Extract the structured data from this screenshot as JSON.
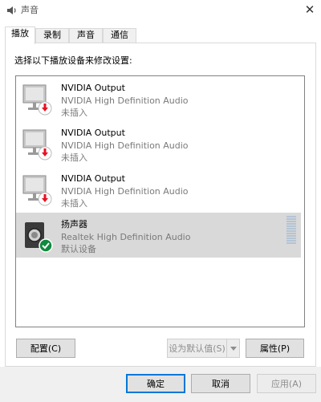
{
  "window": {
    "title": "声音",
    "icon": "speaker-icon",
    "close_glyph": "✕"
  },
  "tabs": [
    {
      "label": "播放",
      "active": true
    },
    {
      "label": "录制",
      "active": false
    },
    {
      "label": "声音",
      "active": false
    },
    {
      "label": "通信",
      "active": false
    }
  ],
  "instruction": "选择以下播放设备来修改设置:",
  "devices": [
    {
      "name": "NVIDIA Output",
      "driver": "NVIDIA High Definition Audio",
      "status": "未插入",
      "icon": "monitor-icon",
      "badge": "unplugged-arrow-icon",
      "selected": false,
      "level_meter": false
    },
    {
      "name": "NVIDIA Output",
      "driver": "NVIDIA High Definition Audio",
      "status": "未插入",
      "icon": "monitor-icon",
      "badge": "unplugged-arrow-icon",
      "selected": false,
      "level_meter": false
    },
    {
      "name": "NVIDIA Output",
      "driver": "NVIDIA High Definition Audio",
      "status": "未插入",
      "icon": "monitor-icon",
      "badge": "unplugged-arrow-icon",
      "selected": false,
      "level_meter": false
    },
    {
      "name": "扬声器",
      "driver": "Realtek High Definition Audio",
      "status": "默认设备",
      "icon": "speaker-icon",
      "badge": "default-check-icon",
      "selected": true,
      "level_meter": true
    }
  ],
  "buttons": {
    "configure": "配置(C)",
    "set_default": "设为默认值(S)",
    "properties": "属性(P)",
    "ok": "确定",
    "cancel": "取消",
    "apply": "应用(A)"
  },
  "colors": {
    "selected_row": "#d9d9d9",
    "unplugged_badge": "#e81123",
    "default_badge": "#10893e",
    "meter": "#b4c4d4"
  }
}
